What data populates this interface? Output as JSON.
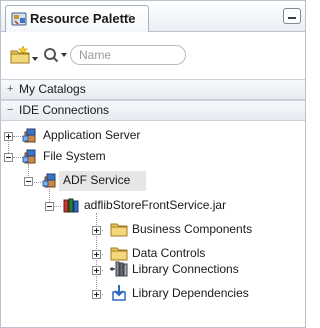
{
  "panel": {
    "title": "Resource Palette",
    "close_glyph": "×"
  },
  "toolbar": {
    "search_placeholder": "Name",
    "icons": [
      "new-folder-icon",
      "chevron-down-icon",
      "search-icon",
      "minimize-icon"
    ]
  },
  "sections": [
    {
      "label": "My Catalogs",
      "toggle": "+"
    },
    {
      "label": "IDE Connections",
      "toggle": "−"
    }
  ],
  "tree": {
    "application_server": "Application Server",
    "file_system": "File System",
    "adf_service": "ADF Service",
    "jar": "adflibStoreFrontService.jar",
    "business_components": "Business Components",
    "data_controls": "Data Controls",
    "library_connections": "Library Connections",
    "library_dependencies": "Library Dependencies"
  },
  "colors": {
    "border": "#b9c2cd",
    "folder": "#e9c75a",
    "selected": "#e6e6e6",
    "accent_blue": "#2f6bc3"
  }
}
